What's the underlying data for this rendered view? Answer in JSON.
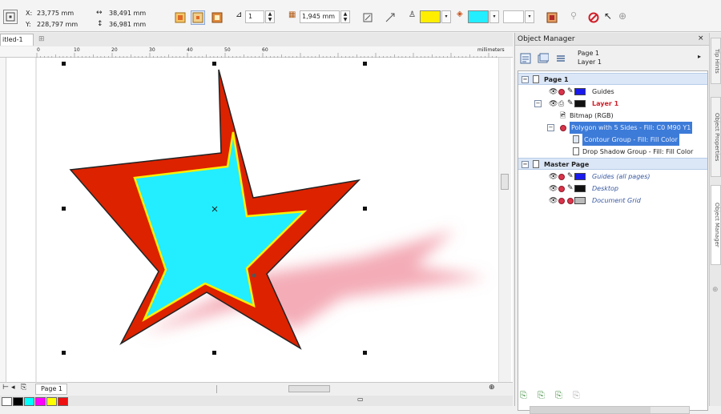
{
  "propbar": {
    "x_label": "X:",
    "x_value": "23,775 mm",
    "y_label": "Y:",
    "y_value": "228,797 mm",
    "w_value": "38,491 mm",
    "h_value": "36,981 mm",
    "contour_steps": "1",
    "contour_offset": "1,945 mm",
    "outline_color": "#ffee00",
    "fill_color": "#22eeff"
  },
  "doc_tab": {
    "label": "itled-1"
  },
  "ruler": {
    "ticks": [
      "0",
      "10",
      "20",
      "30",
      "40",
      "50",
      "60"
    ],
    "unit": "millimeters"
  },
  "page_tab": {
    "label": "Page 1"
  },
  "palette": {
    "colors": [
      "#ffffff",
      "#000000",
      "#00ffff",
      "#ff00ff",
      "#ffff00",
      "#ee1111"
    ]
  },
  "object_manager": {
    "title": "Object Manager",
    "current_page": "Page 1",
    "current_layer": "Layer 1",
    "tree": [
      {
        "kind": "header",
        "label": "Page 1"
      },
      {
        "kind": "layer",
        "label": "Guides",
        "color": "#1a1aee",
        "italic": false,
        "red": false
      },
      {
        "kind": "layer",
        "label": "Layer 1",
        "color": "#111111",
        "italic": false,
        "red": true
      },
      {
        "kind": "object",
        "label": "Bitmap (RGB)"
      },
      {
        "kind": "object-sel",
        "label": "Polygon with 5 Sides - Fill: C0 M90 Y1"
      },
      {
        "kind": "object-sel",
        "label": "Contour Group - Fill: Fill Color"
      },
      {
        "kind": "object",
        "label": "Drop Shadow Group - Fill: Fill Color"
      },
      {
        "kind": "header",
        "label": "Master Page"
      },
      {
        "kind": "layer",
        "label": "Guides (all pages)",
        "color": "#1a1aee",
        "italic": true,
        "red": false
      },
      {
        "kind": "layer",
        "label": "Desktop",
        "color": "#111111",
        "italic": true,
        "red": false
      },
      {
        "kind": "layer",
        "label": "Document Grid",
        "color": "#bbbbbb",
        "italic": true,
        "red": false
      }
    ]
  },
  "side_tabs": [
    "Tip Hints",
    "Object Properties",
    "Object Manager"
  ],
  "colors": {
    "star_outline": "#dd2200",
    "star_fill": "#22eeff",
    "contour_line": "#ffee00",
    "shadow": "#ee8090",
    "selection_row": "#3d7bd8"
  }
}
